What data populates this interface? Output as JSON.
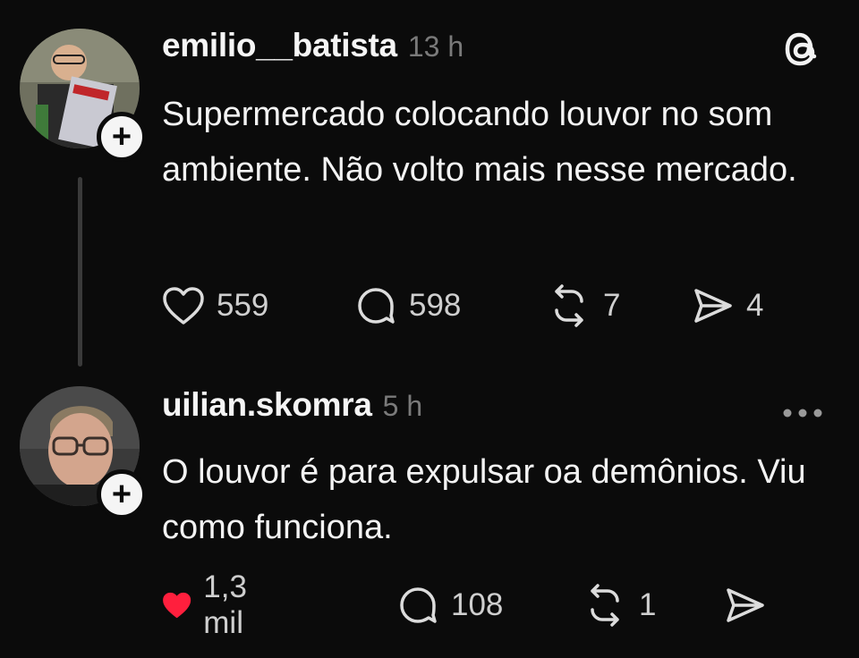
{
  "posts": [
    {
      "username": "emilio__batista",
      "time": "13 h",
      "text": "Supermercado colocando louvor no som ambiente. Não volto mais nesse mercado.",
      "liked": false,
      "stats": {
        "likes": "559",
        "replies": "598",
        "reposts": "7",
        "shares": "4"
      },
      "corner_icon": "threads-logo-icon"
    },
    {
      "username": "uilian.skomra",
      "time": "5 h",
      "text": "O louvor é para expulsar oa demônios. Viu como funciona.",
      "liked": true,
      "stats": {
        "likes": "1,3 mil",
        "replies": "108",
        "reposts": "1",
        "shares": ""
      },
      "corner_icon": "more-icon"
    }
  ],
  "colors": {
    "background": "#0b0b0b",
    "text": "#f3f3f3",
    "muted": "#7a7a7a",
    "like_active": "#ff1f3d",
    "thread_line": "#3a3a3a"
  },
  "follow_symbol": "+"
}
